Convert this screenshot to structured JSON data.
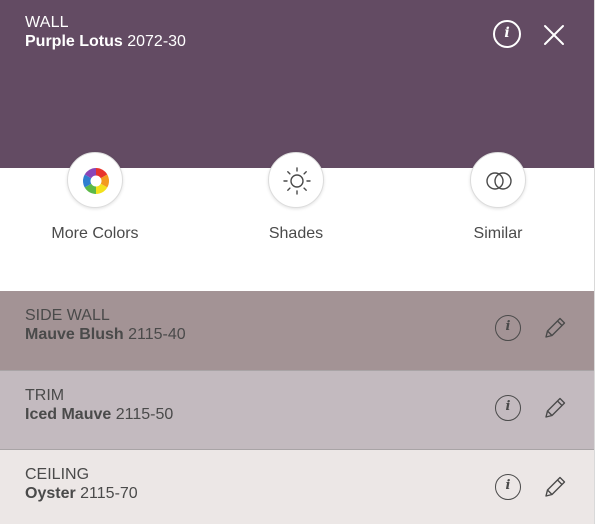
{
  "colors": {
    "accent": "#d9187f",
    "text_dark": "#4a4a4a",
    "header_text": "#ffffff"
  },
  "header": {
    "surface": "WALL",
    "color_name": "Purple Lotus",
    "color_code": "2072-30",
    "swatch": "#634b63",
    "info_icon": "info-icon",
    "close_icon": "close-icon"
  },
  "actions": [
    {
      "label": "More Colors",
      "icon": "color-wheel-icon"
    },
    {
      "label": "Shades",
      "icon": "sun-icon"
    },
    {
      "label": "Similar",
      "icon": "overlapping-circles-icon"
    }
  ],
  "surfaces": [
    {
      "surface": "SIDE WALL",
      "color_name": "Mauve Blush",
      "color_code": "2115-40",
      "swatch": "#a39395"
    },
    {
      "surface": "TRIM",
      "color_name": "Iced Mauve",
      "color_code": "2115-50",
      "swatch": "#c3babf"
    },
    {
      "surface": "CEILING",
      "color_name": "Oyster",
      "color_code": "2115-70",
      "swatch": "#ece7e6"
    }
  ],
  "row_icons": {
    "info": "info-icon",
    "edit": "pencil-icon"
  }
}
